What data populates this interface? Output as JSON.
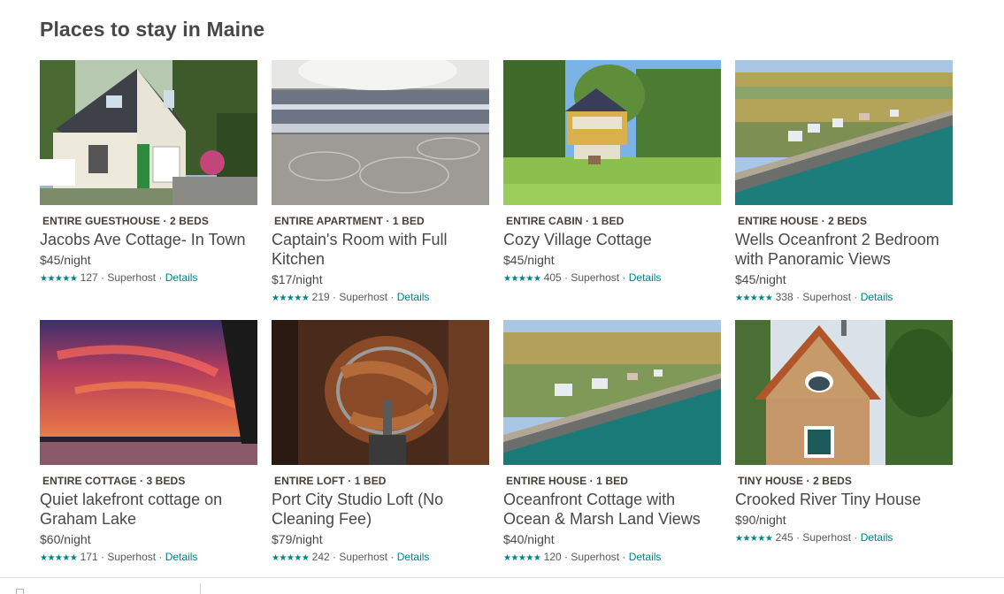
{
  "page": {
    "title": "Places to stay in Maine"
  },
  "colors": {
    "accent": "#008489",
    "text": "#484848",
    "type_label": "#4a3d36"
  },
  "listings": [
    {
      "type": "ENTIRE GUESTHOUSE · 2 BEDS",
      "title": "Jacobs Ave Cottage- In Town",
      "price": "$45/night",
      "stars": "★★★★★",
      "reviews": "127",
      "host_badge": "Superhost",
      "details": "Details",
      "image": "guesthouse-photo"
    },
    {
      "type": "ENTIRE APARTMENT · 1 BED",
      "title": "Captain's Room with Full Kitchen",
      "price": "$17/night",
      "stars": "★★★★★",
      "reviews": "219",
      "host_badge": "Superhost",
      "details": "Details",
      "image": "bedspread-photo"
    },
    {
      "type": "ENTIRE CABIN · 1 BED",
      "title": "Cozy Village Cottage",
      "price": "$45/night",
      "stars": "★★★★★",
      "reviews": "405",
      "host_badge": "Superhost",
      "details": "Details",
      "image": "cabin-photo"
    },
    {
      "type": "ENTIRE HOUSE · 2 BEDS",
      "title": "Wells Oceanfront 2 Bedroom with Panoramic Views",
      "price": "$45/night",
      "stars": "★★★★★",
      "reviews": "338",
      "host_badge": "Superhost",
      "details": "Details",
      "image": "coast-aerial-photo"
    },
    {
      "type": "ENTIRE COTTAGE · 3 BEDS",
      "title": "Quiet lakefront cottage on Graham Lake",
      "price": "$60/night",
      "stars": "★★★★★",
      "reviews": "171",
      "host_badge": "Superhost",
      "details": "Details",
      "image": "sunset-lake-photo"
    },
    {
      "type": "ENTIRE LOFT · 1 BED",
      "title": "Port City Studio Loft (No Cleaning Fee)",
      "price": "$79/night",
      "stars": "★★★★★",
      "reviews": "242",
      "host_badge": "Superhost",
      "details": "Details",
      "image": "spiral-stair-photo"
    },
    {
      "type": "ENTIRE HOUSE · 1 BED",
      "title": "Oceanfront Cottage with Ocean & Marsh Land Views",
      "price": "$40/night",
      "stars": "★★★★★",
      "reviews": "120",
      "host_badge": "Superhost",
      "details": "Details",
      "image": "coast-aerial-photo-2"
    },
    {
      "type": "TINY HOUSE · 2 BEDS",
      "title": "Crooked River Tiny House",
      "price": "$90/night",
      "stars": "★★★★★",
      "reviews": "245",
      "host_badge": "Superhost",
      "details": "Details",
      "image": "tiny-house-photo"
    }
  ]
}
